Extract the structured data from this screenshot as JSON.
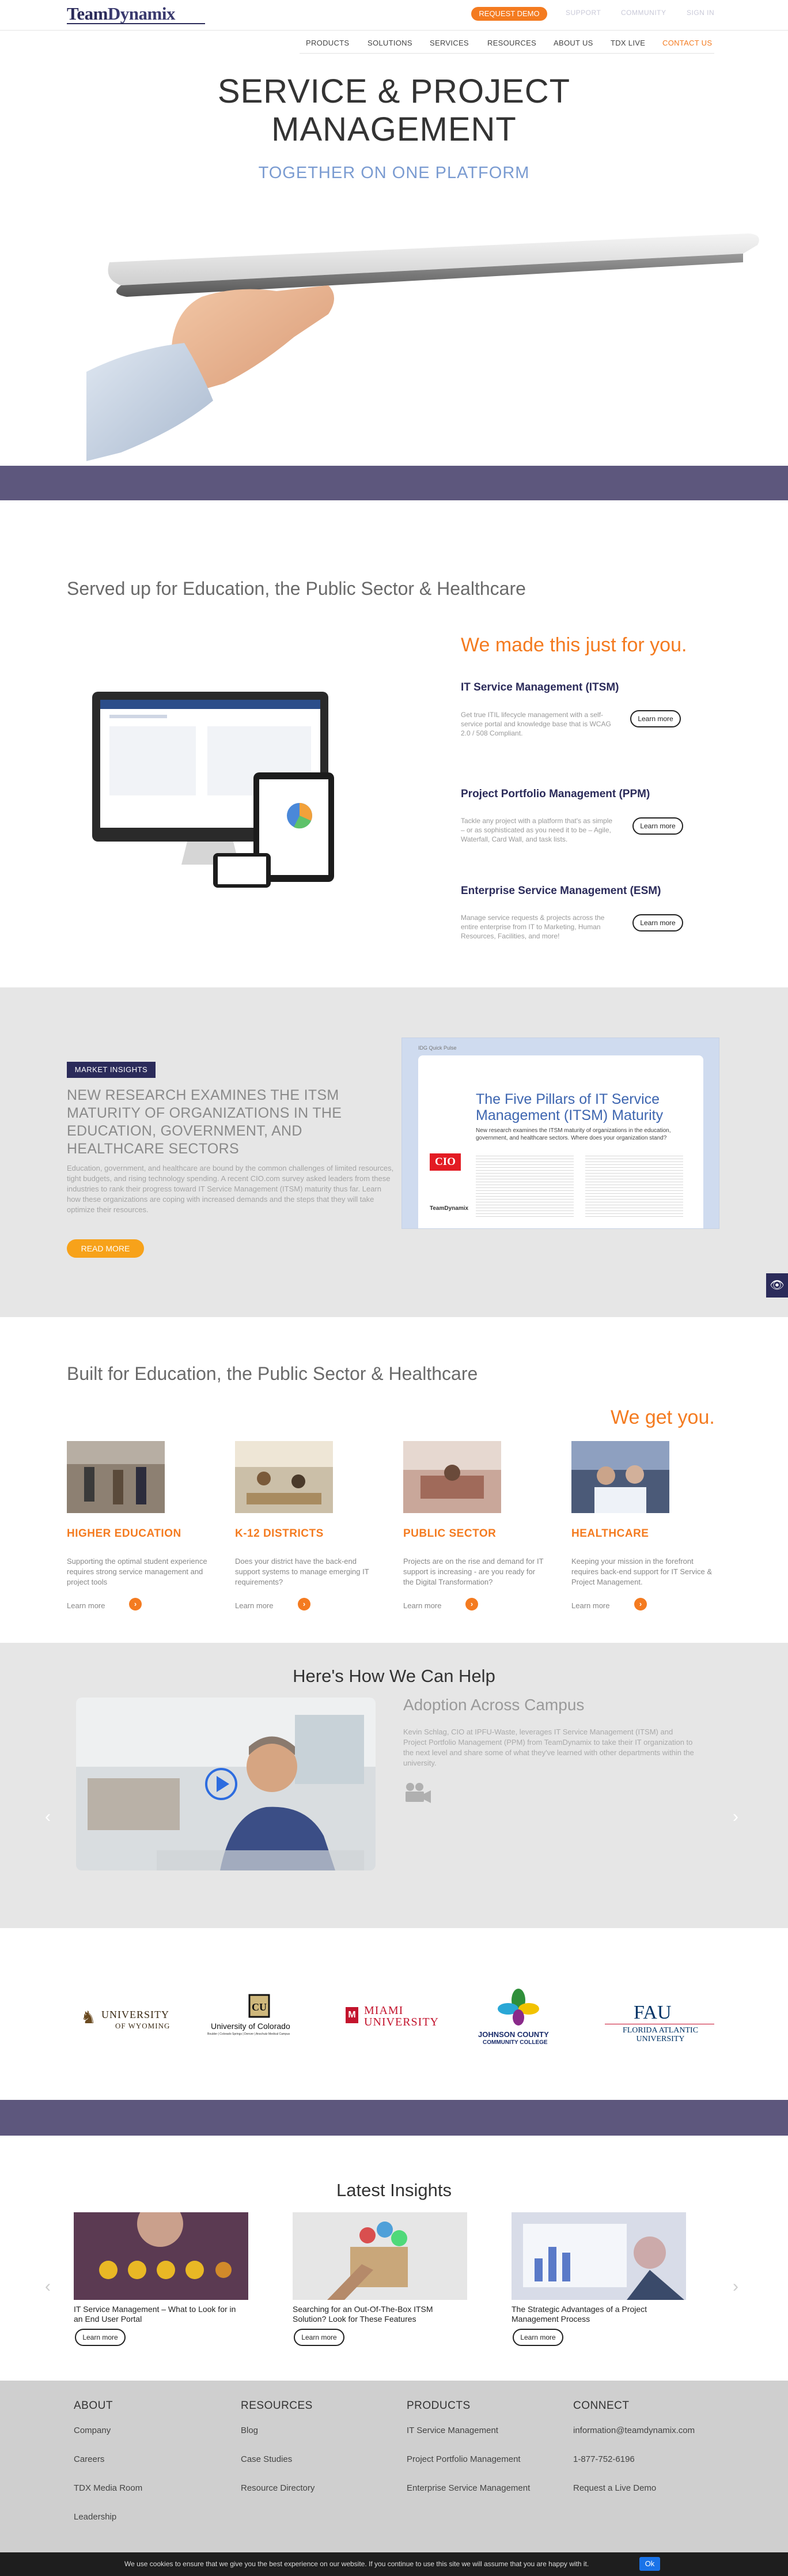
{
  "header": {
    "logo_team": "Team",
    "logo_dynamix": "Dynamix",
    "request_demo": "REQUEST DEMO",
    "util_links": [
      "SUPPORT",
      "COMMUNITY",
      "SIGN IN"
    ],
    "nav": [
      "PRODUCTS",
      "SOLUTIONS",
      "SERVICES",
      "RESOURCES",
      "ABOUT US",
      "TDX LIVE",
      "CONTACT US"
    ]
  },
  "hero": {
    "title_line1": "SERVICE & PROJECT",
    "title_line2": "MANAGEMENT",
    "subtitle": "TOGETHER ON ONE PLATFORM"
  },
  "served": {
    "title": "Served up for Education, the Public Sector & Healthcare",
    "made_title": "We made this just for you.",
    "services": [
      {
        "title": "IT Service Management (ITSM)",
        "desc": "Get true ITIL lifecycle management with a self-service portal and knowledge base that is WCAG 2.0 / 508 Compliant.",
        "button": "Learn more"
      },
      {
        "title": "Project Portfolio Management (PPM)",
        "desc": "Tackle any project with a platform that's as simple – or as sophisticated as you need it to be – Agile, Waterfall, Card Wall, and task lists.",
        "button": "Learn more"
      },
      {
        "title": "Enterprise Service Management (ESM)",
        "desc": "Manage service requests & projects across the entire enterprise from IT to Marketing, Human Resources, Facilities, and more!",
        "button": "Learn more"
      }
    ]
  },
  "market_insights": {
    "badge": "MARKET INSIGHTS",
    "title": "NEW RESEARCH EXAMINES THE ITSM MATURITY OF ORGANIZATIONS IN THE EDUCATION, GOVERNMENT, AND HEALTHCARE SECTORS",
    "body": "Education, government, and healthcare are bound by the common challenges of limited resources, tight budgets, and rising technology spending. A recent CIO.com survey asked leaders from these industries to rank their progress toward IT Service Management (ITSM) maturity thus far. Learn how these organizations are coping with increased demands and the steps that they will take optimize their resources.",
    "button": "READ MORE",
    "report": {
      "tag": "IDG Quick Pulse",
      "title": "The Five Pillars of IT Service Management (ITSM) Maturity",
      "subtitle": "New research examines the ITSM maturity of organizations in the education, government, and healthcare sectors. Where does your organization stand?",
      "cio": "CIO",
      "brand": "TeamDynamix"
    }
  },
  "built": {
    "title": "Built for Education, the Public Sector & Healthcare",
    "get_you": "We get you.",
    "segments": [
      {
        "title": "HIGHER EDUCATION",
        "desc": "Supporting the optimal student experience requires strong service management and project tools",
        "learn": "Learn more"
      },
      {
        "title": "K-12 DISTRICTS",
        "desc": "Does your district have the back-end support systems to manage emerging IT requirements?",
        "learn": "Learn more"
      },
      {
        "title": "PUBLIC SECTOR",
        "desc": "Projects are on the rise and demand for IT support is increasing - are you ready for the Digital Transformation?",
        "learn": "Learn more"
      },
      {
        "title": "HEALTHCARE",
        "desc": "Keeping your mission in the forefront requires back-end support for IT Service & Project Management.",
        "learn": "Learn more"
      }
    ]
  },
  "help": {
    "title": "Here's How We Can Help",
    "case_title": "Adoption Across Campus",
    "case_text": "Kevin Schlag, CIO at IPFU-Waste, leverages IT Service Management (ITSM) and Project Portfolio Management (PPM) from TeamDynamix to take their IT organization to the next level and share some of what they've learned with other departments within the university."
  },
  "logos": [
    {
      "line1": "UNIVERSITY",
      "line2": "OF WYOMING"
    },
    {
      "line1": "University of Colorado",
      "line2": "Boulder | Colorado Springs | Denver | Anschutz Medical Campus"
    },
    {
      "line1": "MIAMI",
      "line2": "UNIVERSITY"
    },
    {
      "line1": "JOHNSON COUNTY",
      "line2": "COMMUNITY COLLEGE"
    },
    {
      "line1": "FAU",
      "line2": "FLORIDA ATLANTIC UNIVERSITY"
    }
  ],
  "insights": {
    "title": "Latest Insights",
    "items": [
      {
        "text": "IT Service Management – What to Look for in an End User Portal",
        "button": "Learn more"
      },
      {
        "text": "Searching for an Out-Of-The-Box ITSM Solution? Look for These Features",
        "button": "Learn more"
      },
      {
        "text": "The Strategic Advantages of a Project Management Process",
        "button": "Learn more"
      }
    ]
  },
  "footer": {
    "columns": [
      {
        "head": "ABOUT",
        "links": [
          "Company",
          "Careers",
          "TDX Media Room",
          "Leadership"
        ]
      },
      {
        "head": "RESOURCES",
        "links": [
          "Blog",
          "Case Studies",
          "Resource Directory"
        ]
      },
      {
        "head": "PRODUCTS",
        "links": [
          "IT Service Management",
          "Project Portfolio Management",
          "Enterprise Service Management"
        ]
      },
      {
        "head": "CONNECT",
        "links": [
          "information@teamdynamix.com",
          "1-877-752-6196",
          "Request a Live Demo"
        ]
      }
    ]
  },
  "cookie": {
    "text": "We use cookies to ensure that we give you the best experience on our website. If you continue to use this site we will assume that you are happy with it.",
    "ok": "Ok"
  },
  "colors": {
    "orange": "#f47b20",
    "navy": "#2b2b5a",
    "purple_band": "#5d577d"
  }
}
